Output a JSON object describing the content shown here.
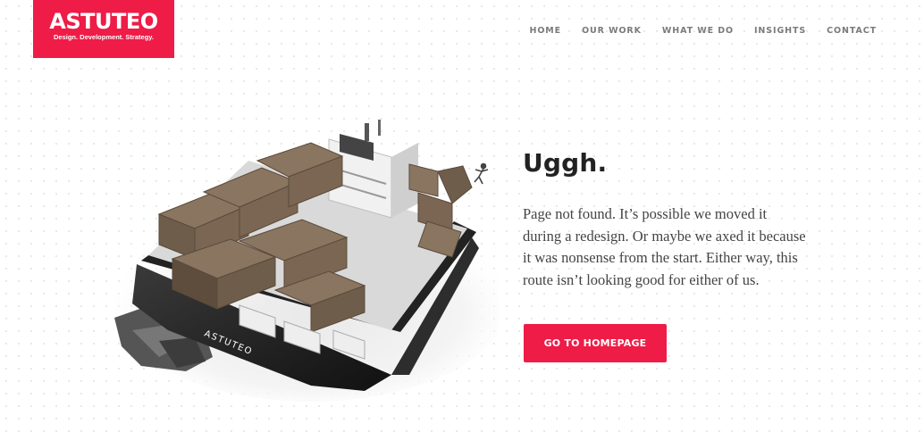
{
  "brand": {
    "name": "ASTUTEO",
    "tagline": "Design. Development. Strategy.",
    "color": "#ee1c47"
  },
  "nav": {
    "items": [
      {
        "label": "HOME"
      },
      {
        "label": "OUR WORK"
      },
      {
        "label": "WHAT WE DO"
      },
      {
        "label": "INSIGHTS"
      },
      {
        "label": "CONTACT"
      }
    ]
  },
  "illustration": {
    "ship_name": "ASTUTEO"
  },
  "error": {
    "headline": "Uggh.",
    "message": "Page not found. It’s possible we moved it during a redesign. Or maybe we axed it because it was nonsense from the start. Either way, this route isn’t looking good for either of us.",
    "cta_label": "GO TO HOMEPAGE"
  }
}
